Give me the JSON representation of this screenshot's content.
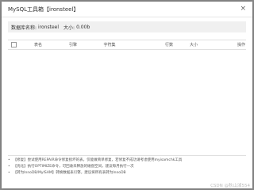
{
  "dialog": {
    "title": "MySQL工具箱【ironsteel】",
    "close_glyph": "×"
  },
  "db_info": {
    "name_label": "数据库名称:",
    "name_value": "ironsteel",
    "size_label": "大小:",
    "size_value": "0.00b"
  },
  "table": {
    "columns": [
      "表名",
      "引擎",
      "字符集",
      "行数",
      "大小",
      "操作"
    ],
    "rows": []
  },
  "notes": [
    "【修复】尝试使用REPAIR命令修复损坏的表，仅能做简单修复，若修复不成功请考虑使用myisamchk工具",
    "【优化】执行OPTIMIZE命令，可回收未释放的磁盘空间，建议每月执行一次",
    "【转为InnoDB/MyISAM】转换数据表引擎，建议将所有表转为InnoDB"
  ],
  "watermark": "CSDN @秋山淖554"
}
